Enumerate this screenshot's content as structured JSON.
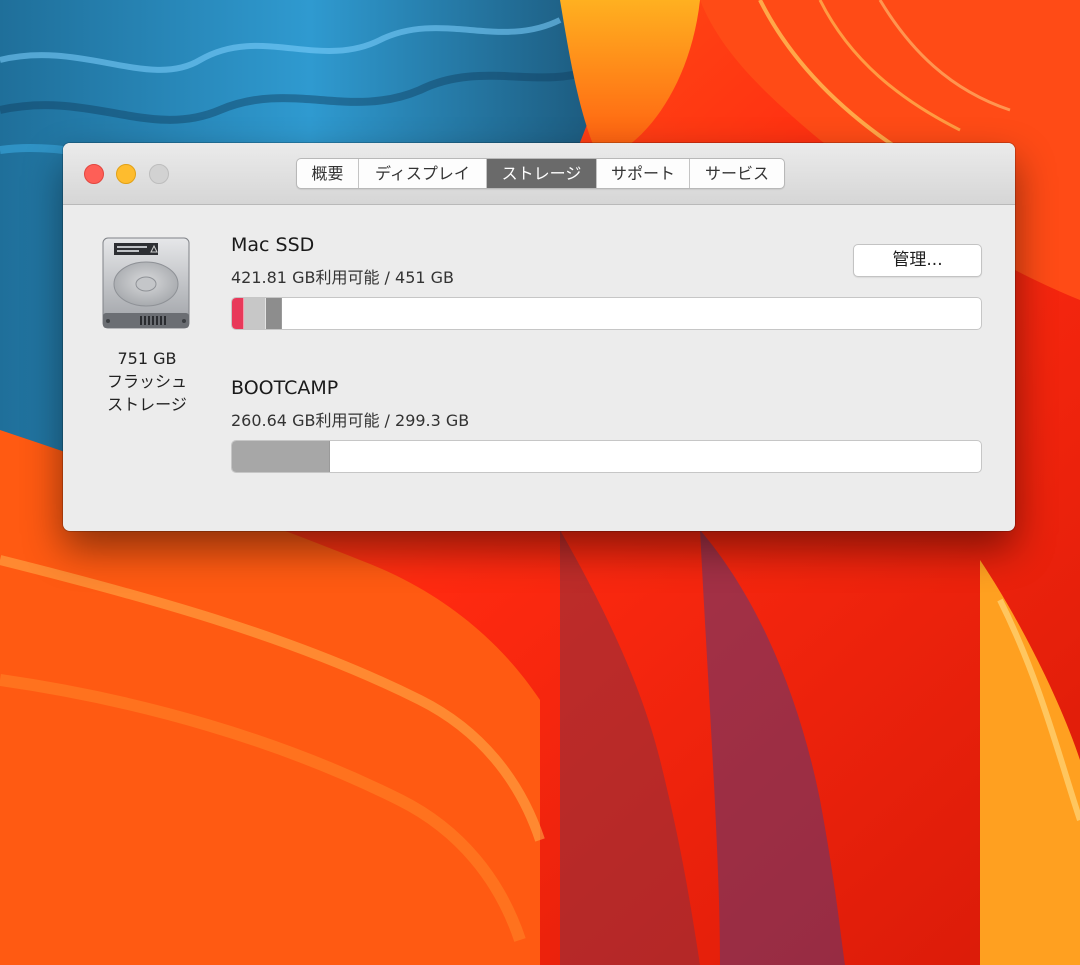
{
  "window": {
    "tabs": [
      {
        "label": "概要",
        "active": false
      },
      {
        "label": "ディスプレイ",
        "active": false
      },
      {
        "label": "ストレージ",
        "active": true
      },
      {
        "label": "サポート",
        "active": false
      },
      {
        "label": "サービス",
        "active": false
      }
    ]
  },
  "disk": {
    "capacity_label": "751 GB",
    "type_line1": "フラッシュ",
    "type_line2": "ストレージ",
    "icon": "hard-drive-icon"
  },
  "volumes": [
    {
      "name": "Mac SSD",
      "info": "421.81 GB利用可能 / 451 GB",
      "usage": [
        {
          "category": "apps",
          "fraction": 0.0146,
          "color": "#e8395a"
        },
        {
          "category": "other",
          "fraction": 0.0281,
          "color": "#c7c7c7"
        },
        {
          "category": "system",
          "fraction": 0.0195,
          "color": "#8d8d8d"
        }
      ]
    },
    {
      "name": "BOOTCAMP",
      "info": "260.64 GB利用可能 / 299.3 GB",
      "usage": [
        {
          "category": "used",
          "fraction": 0.129,
          "color": "#a7a7a7"
        }
      ]
    }
  ],
  "buttons": {
    "manage_label": "管理..."
  },
  "colors": {
    "active_tab": "#6a6a6a",
    "close": "#fe5f57",
    "minimize": "#febc2e",
    "zoom_disabled": "#d2d2d2"
  }
}
